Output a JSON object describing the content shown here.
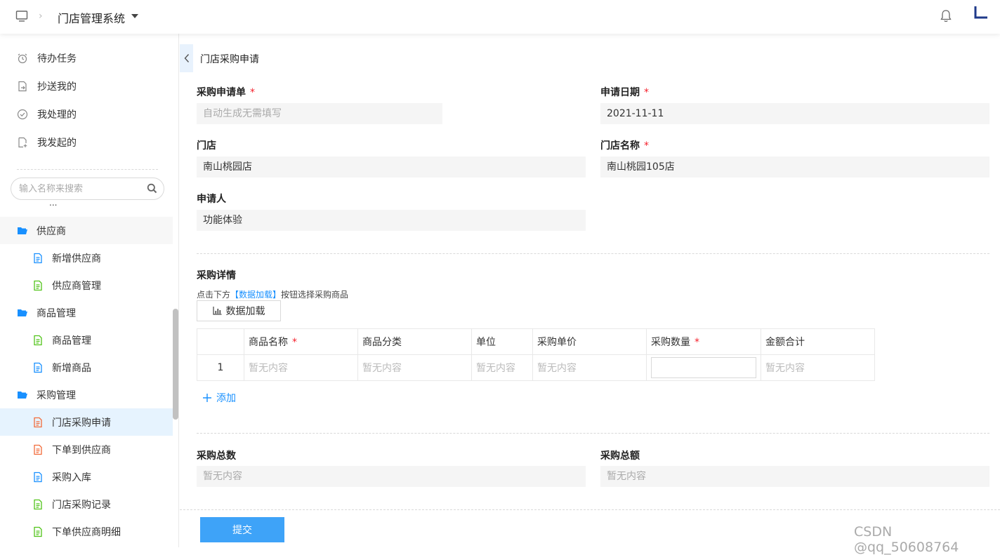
{
  "topbar": {
    "app_name": "门店管理系统"
  },
  "sidebar": {
    "top_items": [
      {
        "label": "待办任务",
        "icon": "alarm-clock-icon"
      },
      {
        "label": "抄送我的",
        "icon": "document-forward-icon"
      },
      {
        "label": "我处理的",
        "icon": "check-circle-icon"
      },
      {
        "label": "我发起的",
        "icon": "document-add-icon"
      }
    ],
    "search_placeholder": "输入名称来搜索",
    "tree": [
      {
        "label": "供应商",
        "type": "folder"
      },
      {
        "label": "新增供应商",
        "type": "leaf",
        "icon_color": "#1890ff"
      },
      {
        "label": "供应商管理",
        "type": "leaf",
        "icon_color": "#52c41a"
      },
      {
        "label": "商品管理",
        "type": "folder"
      },
      {
        "label": "商品管理",
        "type": "leaf",
        "icon_color": "#52c41a"
      },
      {
        "label": "新增商品",
        "type": "leaf",
        "icon_color": "#1890ff"
      },
      {
        "label": "采购管理",
        "type": "folder"
      },
      {
        "label": "门店采购申请",
        "type": "leaf",
        "icon_color": "#f26b3a",
        "active": true
      },
      {
        "label": "下单到供应商",
        "type": "leaf",
        "icon_color": "#f26b3a"
      },
      {
        "label": "采购入库",
        "type": "leaf",
        "icon_color": "#1890ff"
      },
      {
        "label": "门店采购记录",
        "type": "leaf",
        "icon_color": "#52c41a"
      },
      {
        "label": "下单供应商明细",
        "type": "leaf",
        "icon_color": "#52c41a"
      }
    ]
  },
  "form": {
    "title": "门店采购申请",
    "order_no": {
      "label": "采购申请单",
      "required": "*",
      "placeholder": "自动生成无需填写"
    },
    "apply_date": {
      "label": "申请日期",
      "required": "*",
      "value": "2021-11-11"
    },
    "store": {
      "label": "门店",
      "value": "南山桃园店"
    },
    "store_name": {
      "label": "门店名称",
      "required": "*",
      "value": "南山桃园105店"
    },
    "applicant": {
      "label": "申请人",
      "value": "功能体验"
    },
    "details": {
      "section_title": "采购详情",
      "hint_prefix": "点击下方",
      "hint_link": "【数据加载】",
      "hint_suffix": "按钮选择采购商品",
      "load_button": "数据加载",
      "columns": [
        "商品名称",
        "商品分类",
        "单位",
        "采购单价",
        "采购数量",
        "金额合计"
      ],
      "required_mark": "*",
      "rows": [
        {
          "index": "1",
          "name": "暂无内容",
          "category": "暂无内容",
          "unit": "暂无内容",
          "price": "暂无内容",
          "total": "暂无内容"
        }
      ],
      "add_label": "添加"
    },
    "total_qty": {
      "label": "采购总数",
      "value": "暂无内容"
    },
    "total_amount": {
      "label": "采购总额",
      "value": "暂无内容"
    },
    "submit_label": "提交"
  },
  "watermark": "CSDN @qq_50608764",
  "colors": {
    "accent": "#1890ff",
    "submit": "#3ea3f8",
    "required": "#f5222d",
    "active_bg": "#e6f3fe"
  }
}
